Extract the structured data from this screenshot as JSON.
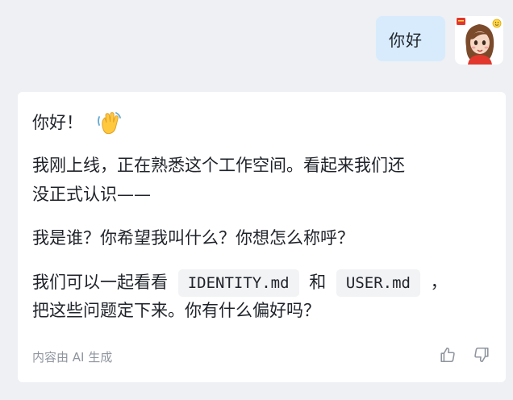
{
  "user_message": {
    "text": "你好"
  },
  "assistant_message": {
    "greeting": "你好！",
    "greeting_emoji": "waving-hand-icon",
    "paragraph_1_line_1": "我刚上线，正在熟悉这个工作空间。看起来我们还",
    "paragraph_1_line_2": "没正式认识——",
    "paragraph_2": "我是谁？你希望我叫什么？你想怎么称呼？",
    "paragraph_3_prefix": "我们可以一起看看",
    "code_1": "IDENTITY.md",
    "paragraph_3_and": "和",
    "code_2": "USER.md",
    "paragraph_3_suffix": "，",
    "paragraph_3_line_2": "把这些问题定下来。你有什么偏好吗？",
    "footer_note": "内容由 AI 生成",
    "feedback": {
      "thumbs_up": "thumbs-up-icon",
      "thumbs_down": "thumbs-down-icon"
    }
  },
  "colors": {
    "background": "#eef0f3",
    "user_bubble": "#d7ebfd",
    "card": "#ffffff",
    "text": "#1f2329",
    "muted": "#8f959e",
    "code_bg": "#f2f3f5"
  }
}
